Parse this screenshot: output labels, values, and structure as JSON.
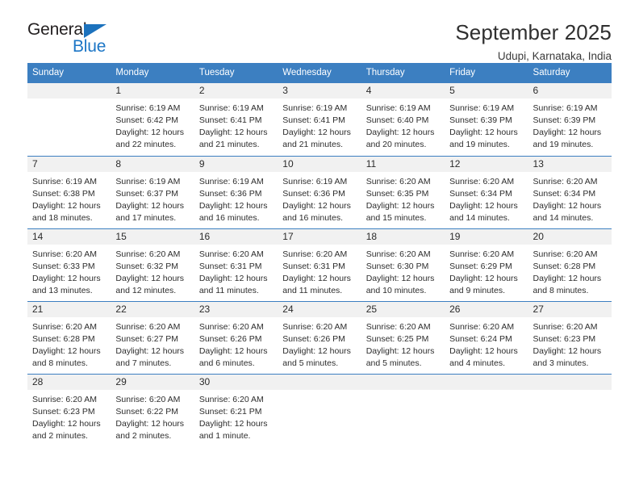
{
  "brand": {
    "name_part1": "General",
    "name_part2": "Blue",
    "accent_color": "#1c76c6",
    "triangle_color": "#1c72bd"
  },
  "header": {
    "title": "September 2025",
    "subtitle": "Udupi, Karnataka, India"
  },
  "calendar": {
    "header_color": "#3c7fc1",
    "daynumber_band_color": "#f1f1f1",
    "weekdays": [
      "Sunday",
      "Monday",
      "Tuesday",
      "Wednesday",
      "Thursday",
      "Friday",
      "Saturday"
    ],
    "weeks": [
      [
        {
          "day": "",
          "sunrise": "",
          "sunset": "",
          "daylight_line1": "",
          "daylight_line2": ""
        },
        {
          "day": "1",
          "sunrise": "Sunrise: 6:19 AM",
          "sunset": "Sunset: 6:42 PM",
          "daylight_line1": "Daylight: 12 hours",
          "daylight_line2": "and 22 minutes."
        },
        {
          "day": "2",
          "sunrise": "Sunrise: 6:19 AM",
          "sunset": "Sunset: 6:41 PM",
          "daylight_line1": "Daylight: 12 hours",
          "daylight_line2": "and 21 minutes."
        },
        {
          "day": "3",
          "sunrise": "Sunrise: 6:19 AM",
          "sunset": "Sunset: 6:41 PM",
          "daylight_line1": "Daylight: 12 hours",
          "daylight_line2": "and 21 minutes."
        },
        {
          "day": "4",
          "sunrise": "Sunrise: 6:19 AM",
          "sunset": "Sunset: 6:40 PM",
          "daylight_line1": "Daylight: 12 hours",
          "daylight_line2": "and 20 minutes."
        },
        {
          "day": "5",
          "sunrise": "Sunrise: 6:19 AM",
          "sunset": "Sunset: 6:39 PM",
          "daylight_line1": "Daylight: 12 hours",
          "daylight_line2": "and 19 minutes."
        },
        {
          "day": "6",
          "sunrise": "Sunrise: 6:19 AM",
          "sunset": "Sunset: 6:39 PM",
          "daylight_line1": "Daylight: 12 hours",
          "daylight_line2": "and 19 minutes."
        }
      ],
      [
        {
          "day": "7",
          "sunrise": "Sunrise: 6:19 AM",
          "sunset": "Sunset: 6:38 PM",
          "daylight_line1": "Daylight: 12 hours",
          "daylight_line2": "and 18 minutes."
        },
        {
          "day": "8",
          "sunrise": "Sunrise: 6:19 AM",
          "sunset": "Sunset: 6:37 PM",
          "daylight_line1": "Daylight: 12 hours",
          "daylight_line2": "and 17 minutes."
        },
        {
          "day": "9",
          "sunrise": "Sunrise: 6:19 AM",
          "sunset": "Sunset: 6:36 PM",
          "daylight_line1": "Daylight: 12 hours",
          "daylight_line2": "and 16 minutes."
        },
        {
          "day": "10",
          "sunrise": "Sunrise: 6:19 AM",
          "sunset": "Sunset: 6:36 PM",
          "daylight_line1": "Daylight: 12 hours",
          "daylight_line2": "and 16 minutes."
        },
        {
          "day": "11",
          "sunrise": "Sunrise: 6:20 AM",
          "sunset": "Sunset: 6:35 PM",
          "daylight_line1": "Daylight: 12 hours",
          "daylight_line2": "and 15 minutes."
        },
        {
          "day": "12",
          "sunrise": "Sunrise: 6:20 AM",
          "sunset": "Sunset: 6:34 PM",
          "daylight_line1": "Daylight: 12 hours",
          "daylight_line2": "and 14 minutes."
        },
        {
          "day": "13",
          "sunrise": "Sunrise: 6:20 AM",
          "sunset": "Sunset: 6:34 PM",
          "daylight_line1": "Daylight: 12 hours",
          "daylight_line2": "and 14 minutes."
        }
      ],
      [
        {
          "day": "14",
          "sunrise": "Sunrise: 6:20 AM",
          "sunset": "Sunset: 6:33 PM",
          "daylight_line1": "Daylight: 12 hours",
          "daylight_line2": "and 13 minutes."
        },
        {
          "day": "15",
          "sunrise": "Sunrise: 6:20 AM",
          "sunset": "Sunset: 6:32 PM",
          "daylight_line1": "Daylight: 12 hours",
          "daylight_line2": "and 12 minutes."
        },
        {
          "day": "16",
          "sunrise": "Sunrise: 6:20 AM",
          "sunset": "Sunset: 6:31 PM",
          "daylight_line1": "Daylight: 12 hours",
          "daylight_line2": "and 11 minutes."
        },
        {
          "day": "17",
          "sunrise": "Sunrise: 6:20 AM",
          "sunset": "Sunset: 6:31 PM",
          "daylight_line1": "Daylight: 12 hours",
          "daylight_line2": "and 11 minutes."
        },
        {
          "day": "18",
          "sunrise": "Sunrise: 6:20 AM",
          "sunset": "Sunset: 6:30 PM",
          "daylight_line1": "Daylight: 12 hours",
          "daylight_line2": "and 10 minutes."
        },
        {
          "day": "19",
          "sunrise": "Sunrise: 6:20 AM",
          "sunset": "Sunset: 6:29 PM",
          "daylight_line1": "Daylight: 12 hours",
          "daylight_line2": "and 9 minutes."
        },
        {
          "day": "20",
          "sunrise": "Sunrise: 6:20 AM",
          "sunset": "Sunset: 6:28 PM",
          "daylight_line1": "Daylight: 12 hours",
          "daylight_line2": "and 8 minutes."
        }
      ],
      [
        {
          "day": "21",
          "sunrise": "Sunrise: 6:20 AM",
          "sunset": "Sunset: 6:28 PM",
          "daylight_line1": "Daylight: 12 hours",
          "daylight_line2": "and 8 minutes."
        },
        {
          "day": "22",
          "sunrise": "Sunrise: 6:20 AM",
          "sunset": "Sunset: 6:27 PM",
          "daylight_line1": "Daylight: 12 hours",
          "daylight_line2": "and 7 minutes."
        },
        {
          "day": "23",
          "sunrise": "Sunrise: 6:20 AM",
          "sunset": "Sunset: 6:26 PM",
          "daylight_line1": "Daylight: 12 hours",
          "daylight_line2": "and 6 minutes."
        },
        {
          "day": "24",
          "sunrise": "Sunrise: 6:20 AM",
          "sunset": "Sunset: 6:26 PM",
          "daylight_line1": "Daylight: 12 hours",
          "daylight_line2": "and 5 minutes."
        },
        {
          "day": "25",
          "sunrise": "Sunrise: 6:20 AM",
          "sunset": "Sunset: 6:25 PM",
          "daylight_line1": "Daylight: 12 hours",
          "daylight_line2": "and 5 minutes."
        },
        {
          "day": "26",
          "sunrise": "Sunrise: 6:20 AM",
          "sunset": "Sunset: 6:24 PM",
          "daylight_line1": "Daylight: 12 hours",
          "daylight_line2": "and 4 minutes."
        },
        {
          "day": "27",
          "sunrise": "Sunrise: 6:20 AM",
          "sunset": "Sunset: 6:23 PM",
          "daylight_line1": "Daylight: 12 hours",
          "daylight_line2": "and 3 minutes."
        }
      ],
      [
        {
          "day": "28",
          "sunrise": "Sunrise: 6:20 AM",
          "sunset": "Sunset: 6:23 PM",
          "daylight_line1": "Daylight: 12 hours",
          "daylight_line2": "and 2 minutes."
        },
        {
          "day": "29",
          "sunrise": "Sunrise: 6:20 AM",
          "sunset": "Sunset: 6:22 PM",
          "daylight_line1": "Daylight: 12 hours",
          "daylight_line2": "and 2 minutes."
        },
        {
          "day": "30",
          "sunrise": "Sunrise: 6:20 AM",
          "sunset": "Sunset: 6:21 PM",
          "daylight_line1": "Daylight: 12 hours",
          "daylight_line2": "and 1 minute."
        },
        {
          "day": "",
          "sunrise": "",
          "sunset": "",
          "daylight_line1": "",
          "daylight_line2": ""
        },
        {
          "day": "",
          "sunrise": "",
          "sunset": "",
          "daylight_line1": "",
          "daylight_line2": ""
        },
        {
          "day": "",
          "sunrise": "",
          "sunset": "",
          "daylight_line1": "",
          "daylight_line2": ""
        },
        {
          "day": "",
          "sunrise": "",
          "sunset": "",
          "daylight_line1": "",
          "daylight_line2": ""
        }
      ]
    ]
  }
}
